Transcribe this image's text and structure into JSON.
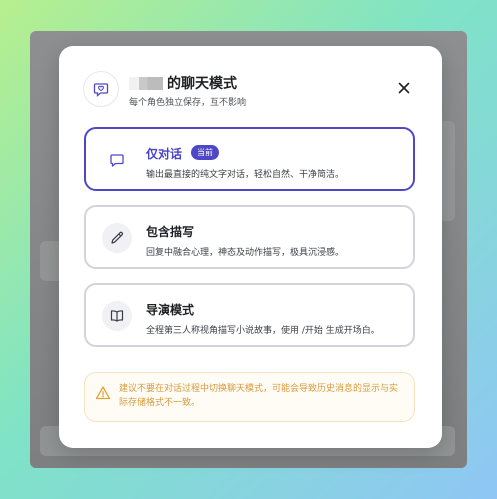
{
  "dialog": {
    "title": "的聊天模式",
    "subtitle": "每个角色独立保存，互不影响",
    "header_icon": "heart-chat-icon",
    "close_icon": "close-icon"
  },
  "options": [
    {
      "title": "仅对话",
      "badge": "当前",
      "desc": "输出最直接的纯文字对话，轻松自然、干净简洁。",
      "icon": "chat-bubble-icon",
      "selected": true
    },
    {
      "title": "包含描写",
      "desc": "回复中融合心理，神态及动作描写，极具沉浸感。",
      "icon": "pen-icon",
      "selected": false
    },
    {
      "title": "导演模式",
      "desc": "全程第三人称视角描写小说故事，使用 /开始 生成开场白。",
      "icon": "book-icon",
      "selected": false
    }
  ],
  "warning": {
    "text": "建议不要在对话过程中切换聊天模式，可能会导致历史消息的显示与实际存储格式不一致。",
    "icon": "warning-triangle-icon"
  },
  "colors": {
    "accent": "#4f48c6",
    "warning": "#d69a3d",
    "border": "#d3d3de"
  }
}
